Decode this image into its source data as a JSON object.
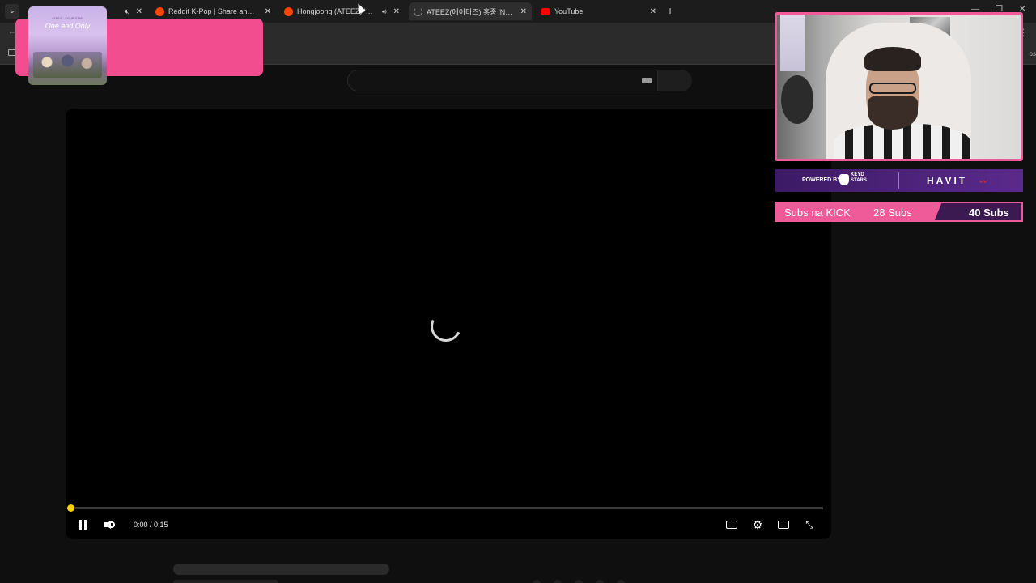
{
  "browser": {
    "tabs": [
      {
        "title": "be",
        "favicon": "youtube",
        "muted": true,
        "active": false
      },
      {
        "title": "Reddit K-Pop | Share and disco",
        "favicon": "reddit",
        "active": false
      },
      {
        "title": "Hongjoong (ATEEZ) 'NO1' |",
        "favicon": "reddit",
        "audio": true,
        "active": false
      },
      {
        "title": "ATEEZ(에이티즈) 홍중 'NO1' | A",
        "favicon": "loading",
        "active": true
      },
      {
        "title": "YouTube",
        "favicon": "youtube",
        "active": false
      }
    ],
    "new_tab_label": "+",
    "bookmarks_tail": "os"
  },
  "player": {
    "time_display": "0:00 / 0:15",
    "progress_fraction": 0.0,
    "accent": "#f5d000"
  },
  "overlay": {
    "song_card": {
      "album_small_text": "ATEEZ · YOUR STAR",
      "album_title": "One and Only",
      "color": "#f24d8e"
    },
    "sponsor": {
      "powered_by": "POWERED BY",
      "brand1": "KEYD STARS",
      "brand2": "HAVIT"
    },
    "subs": {
      "label": "Subs na KICK",
      "current": "28 Subs",
      "goal": "40 Subs"
    }
  }
}
